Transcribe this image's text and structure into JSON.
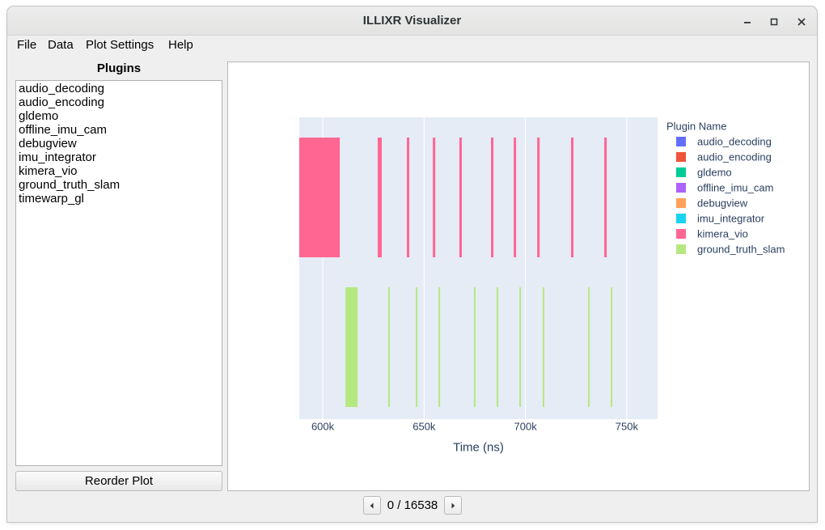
{
  "window": {
    "title": "ILLIXR Visualizer",
    "controls": [
      "minimize-icon",
      "maximize-icon",
      "close-icon"
    ]
  },
  "menu": {
    "items": [
      "File",
      "Data",
      "Plot Settings",
      "Help"
    ]
  },
  "plugins_panel": {
    "title": "Plugins",
    "items": [
      "audio_decoding",
      "audio_encoding",
      "gldemo",
      "offline_imu_cam",
      "debugview",
      "imu_integrator",
      "kimera_vio",
      "ground_truth_slam",
      "timewarp_gl"
    ],
    "reorder_label": "Reorder Plot"
  },
  "navigator": {
    "prev_icon": "chevron-left-icon",
    "counter": "0 / 16538",
    "next_icon": "chevron-right-icon"
  },
  "chart_data": {
    "type": "bar",
    "xlabel": "Time (ns)",
    "xlim": [
      588400,
      765200
    ],
    "xticks": [
      {
        "value": 600000,
        "label": "600k"
      },
      {
        "value": 650000,
        "label": "650k"
      },
      {
        "value": 700000,
        "label": "700k"
      },
      {
        "value": 750000,
        "label": "750k"
      }
    ],
    "grid": true,
    "plot_bg": "#e5ecf6",
    "legend": {
      "title": "Plugin Name",
      "position": "right"
    },
    "series": [
      {
        "name": "audio_decoding",
        "color": "#636efa",
        "segments": []
      },
      {
        "name": "audio_encoding",
        "color": "#ef553b",
        "segments": []
      },
      {
        "name": "gldemo",
        "color": "#00cc96",
        "segments": []
      },
      {
        "name": "offline_imu_cam",
        "color": "#ab63fa",
        "segments": []
      },
      {
        "name": "debugview",
        "color": "#ffa15a",
        "segments": []
      },
      {
        "name": "imu_integrator",
        "color": "#19d3f3",
        "segments": []
      },
      {
        "name": "kimera_vio",
        "color": "#ff6692",
        "segments": [
          [
            588400,
            608400
          ],
          [
            627100,
            629100
          ],
          [
            641500,
            642700
          ],
          [
            654300,
            655500
          ],
          [
            667400,
            668600
          ],
          [
            683000,
            684200
          ],
          [
            694200,
            695400
          ],
          [
            705800,
            707000
          ],
          [
            722500,
            723700
          ],
          [
            738900,
            740100
          ]
        ]
      },
      {
        "name": "ground_truth_slam",
        "color": "#b6e880",
        "segments": [
          [
            611200,
            617200
          ],
          [
            632300,
            633100
          ],
          [
            645900,
            646700
          ],
          [
            657100,
            657900
          ],
          [
            674600,
            675400
          ],
          [
            685800,
            686600
          ],
          [
            697000,
            697800
          ],
          [
            708500,
            709300
          ],
          [
            730900,
            731700
          ],
          [
            742100,
            742900
          ]
        ]
      }
    ]
  }
}
